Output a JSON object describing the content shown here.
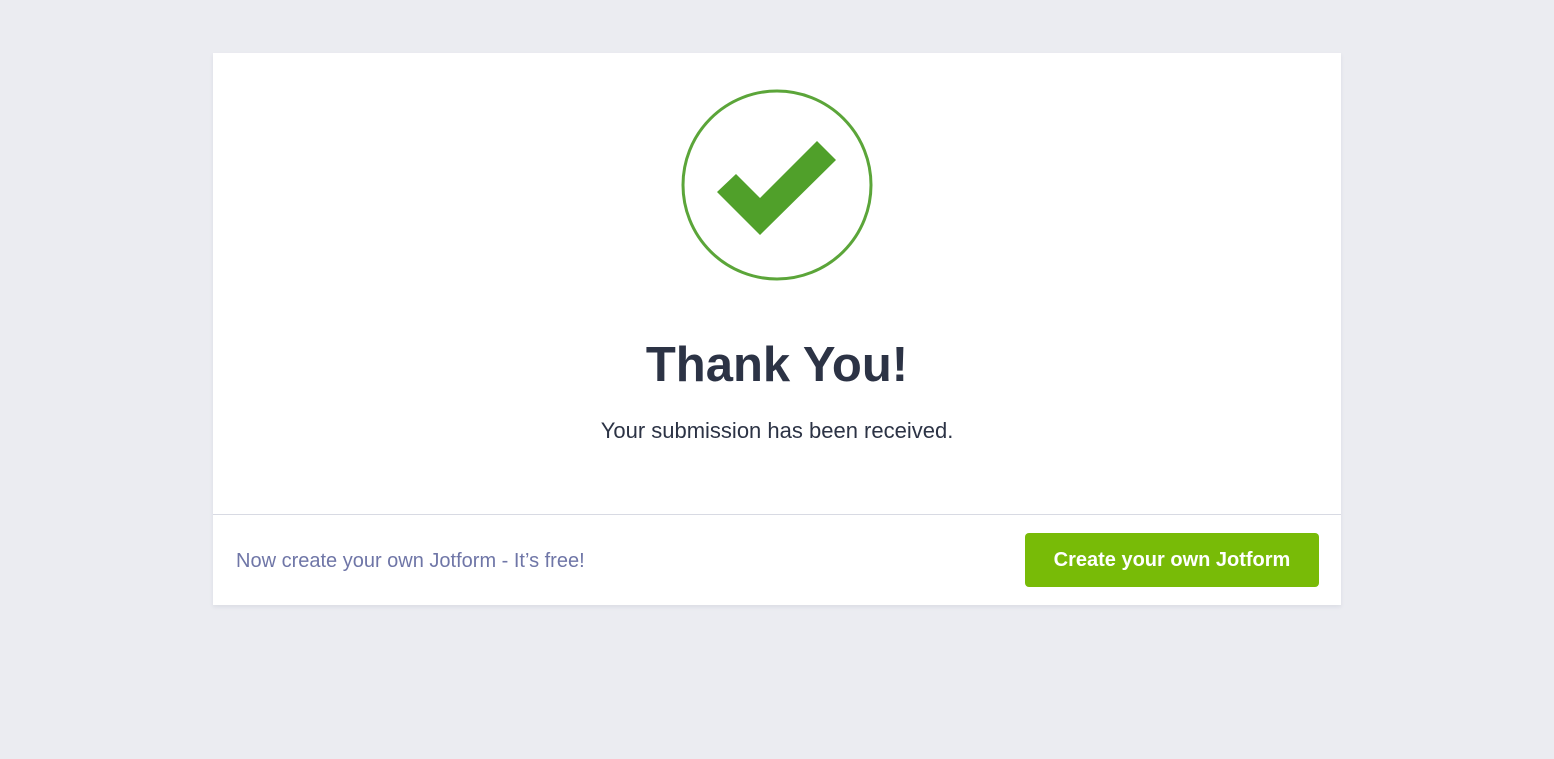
{
  "success": {
    "icon": "checkmark-circle-icon",
    "title": "Thank You!",
    "message": "Your submission has been received."
  },
  "footer": {
    "promo_text": "Now create your own Jotform - It’s free!",
    "cta_label": "Create your own Jotform"
  },
  "colors": {
    "background": "#ebecf1",
    "card": "#ffffff",
    "check_green": "#50a02a",
    "heading_text": "#2c3345",
    "promo_text": "#6f76a7",
    "cta_button": "#78bb07"
  }
}
